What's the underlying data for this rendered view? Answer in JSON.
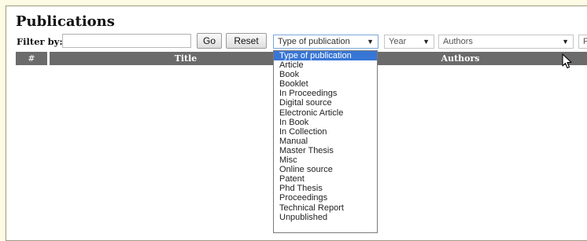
{
  "page": {
    "title": "Publications"
  },
  "filter": {
    "label": "Filter by:",
    "input_value": "",
    "go_label": "Go",
    "reset_label": "Reset",
    "type_select": {
      "value": "Type of publication",
      "expanded": true
    },
    "year_select": {
      "value": "Year"
    },
    "authors_select": {
      "value": "Authors"
    },
    "more_select": {
      "value": "F"
    }
  },
  "table": {
    "columns": [
      "#",
      "Title",
      "Authors"
    ]
  },
  "dropdown": {
    "selected_index": 0,
    "options": [
      "Type of publication",
      "Article",
      "Book",
      "Booklet",
      "In Proceedings",
      "Digital source",
      "Electronic Article",
      "In Book",
      "In Collection",
      "Manual",
      "Master Thesis",
      "Misc",
      "Online source",
      "Patent",
      "Phd Thesis",
      "Proceedings",
      "Technical Report",
      "Unpublished"
    ]
  },
  "colors": {
    "page_background": "#fdfbe3",
    "header_background": "#6b6b6b",
    "selection_highlight": "#3876d6"
  },
  "icons": {
    "cursor": "arrow-pointer-icon",
    "select_arrow": "triangle-down-icon"
  }
}
